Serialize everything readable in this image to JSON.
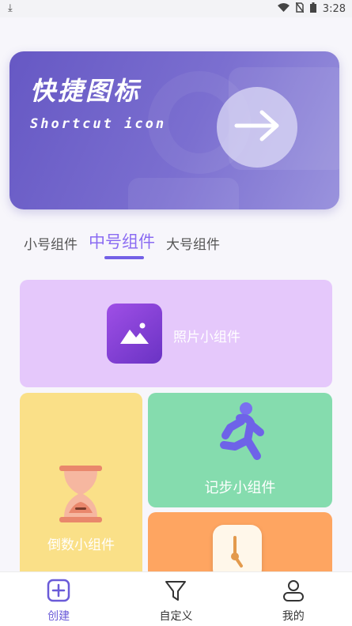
{
  "status_bar": {
    "time": "3:28"
  },
  "banner": {
    "title": "快捷图标",
    "subtitle": "Shortcut icon"
  },
  "tabs": [
    {
      "label": "小号组件",
      "active": false
    },
    {
      "label": "中号组件",
      "active": true
    },
    {
      "label": "大号组件",
      "active": false
    }
  ],
  "widgets": {
    "photo": {
      "label": "照片小组件",
      "icon": "image-icon"
    },
    "countdown": {
      "label": "倒数小组件",
      "icon": "hourglass-icon"
    },
    "steps": {
      "label": "记步小组件",
      "icon": "runner-icon"
    },
    "clock": {
      "icon": "clock-icon"
    }
  },
  "colors": {
    "banner": "#6658c4",
    "accent": "#7360e6",
    "photo_card": "#e5c8fb",
    "countdown_card": "#fae088",
    "steps_card": "#85dcae",
    "clock_card": "#fea561"
  },
  "bottom_nav": [
    {
      "label": "创建",
      "icon": "plus-square-icon",
      "active": true
    },
    {
      "label": "自定义",
      "icon": "filter-icon",
      "active": false
    },
    {
      "label": "我的",
      "icon": "user-icon",
      "active": false
    }
  ]
}
